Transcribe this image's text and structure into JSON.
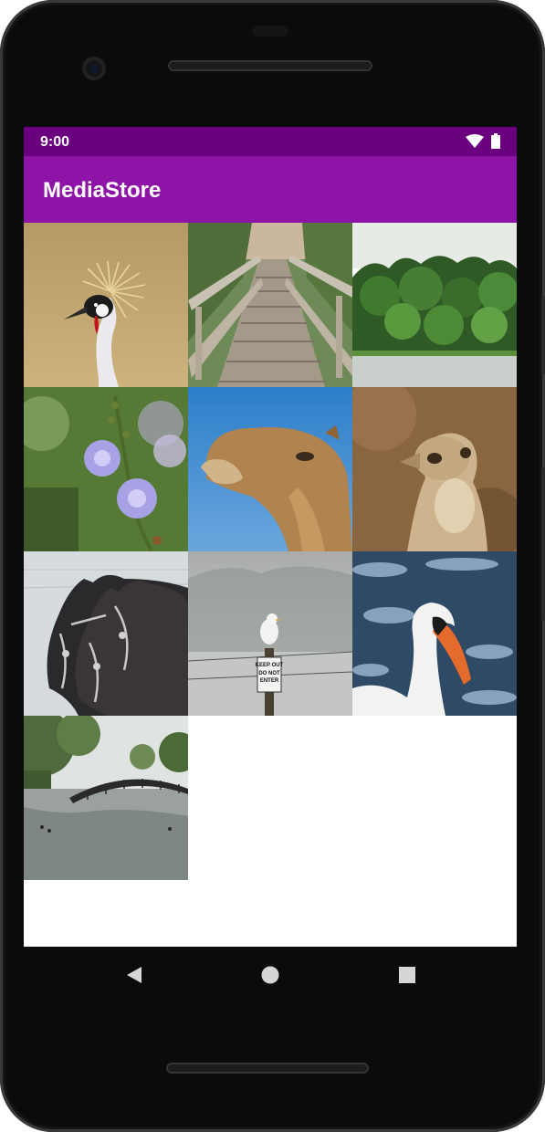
{
  "status_bar": {
    "time": "9:00",
    "background": "#6a0080"
  },
  "app_bar": {
    "title": "MediaStore",
    "background": "#8e14a8"
  },
  "gallery": {
    "images": [
      {
        "subject": "crowned crane"
      },
      {
        "subject": "wooden boardwalk"
      },
      {
        "subject": "forest by a lake"
      },
      {
        "subject": "chicory flowers"
      },
      {
        "subject": "camel"
      },
      {
        "subject": "meerkat"
      },
      {
        "subject": "draft horses"
      },
      {
        "subject": "gull on a post",
        "sign_text": [
          "KEEP OUT",
          "DO NOT",
          "ENTER"
        ]
      },
      {
        "subject": "swan"
      },
      {
        "subject": "arched footbridge over a pond"
      }
    ]
  },
  "nav_bar": {
    "buttons": [
      "back",
      "home",
      "overview"
    ]
  }
}
